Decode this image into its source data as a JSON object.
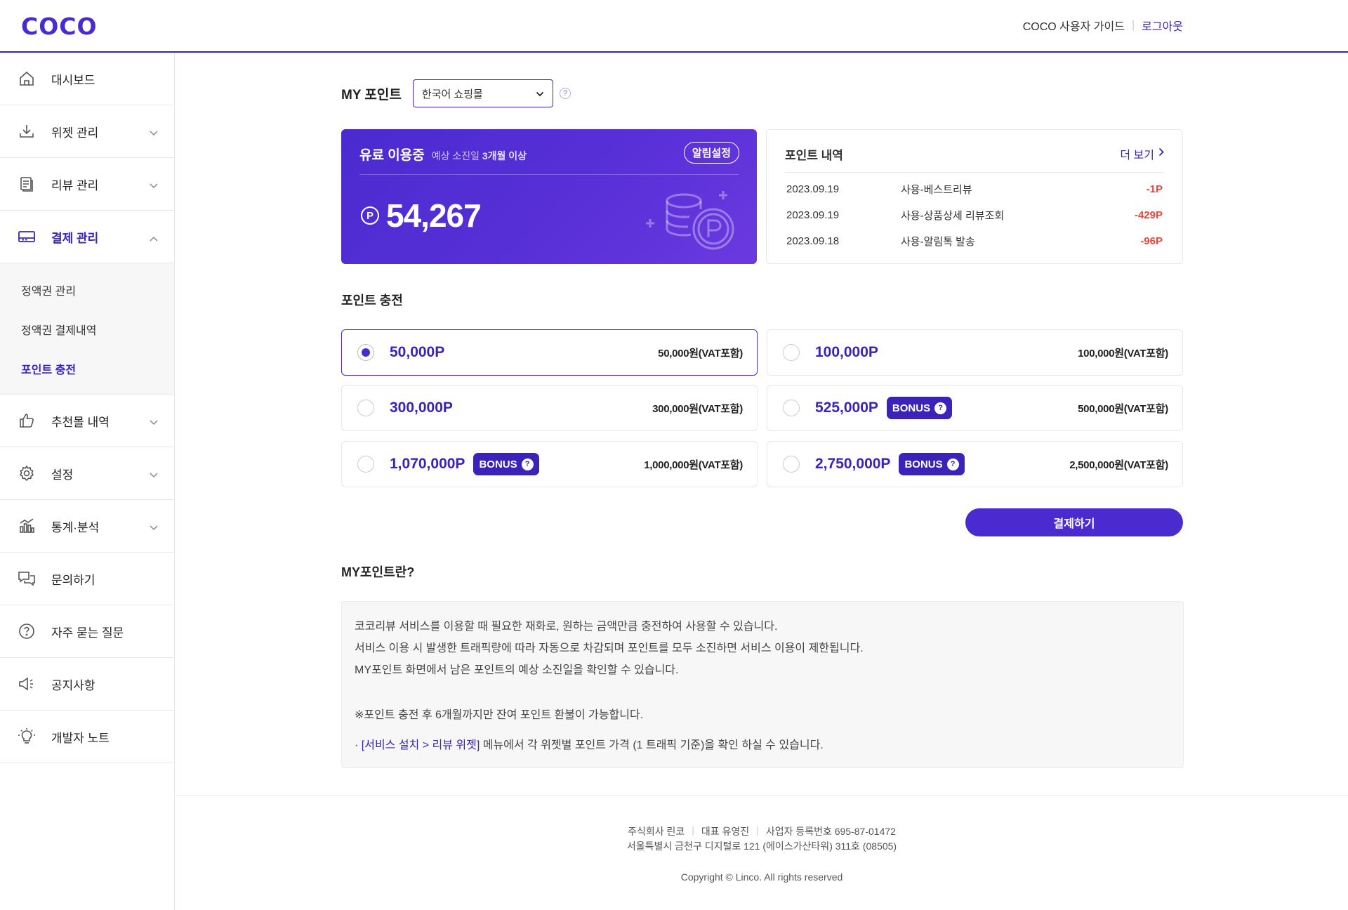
{
  "header": {
    "logo": "COCO",
    "guide_link": "COCO 사용자 가이드",
    "separator": "|",
    "logout": "로그아웃"
  },
  "sidebar": {
    "items": [
      {
        "label": "대시보드",
        "icon": "home-icon"
      },
      {
        "label": "위젯 관리",
        "icon": "download-icon"
      },
      {
        "label": "리뷰 관리",
        "icon": "document-icon"
      },
      {
        "label": "결제 관리",
        "icon": "credit-card-icon"
      },
      {
        "label": "추천몰 내역",
        "icon": "thumbs-up-icon"
      },
      {
        "label": "설정",
        "icon": "gear-icon"
      },
      {
        "label": "통계·분석",
        "icon": "chart-icon"
      },
      {
        "label": "문의하기",
        "icon": "chat-icon"
      },
      {
        "label": "자주 묻는 질문",
        "icon": "question-circle-icon"
      },
      {
        "label": "공지사항",
        "icon": "megaphone-icon"
      },
      {
        "label": "개발자 노트",
        "icon": "lightbulb-icon"
      }
    ],
    "payment_submenu": [
      "정액권 관리",
      "정액권 결제내역",
      "포인트 충전"
    ]
  },
  "mypoint": {
    "title": "MY 포인트",
    "selected_mall": "한국어 쇼핑몰",
    "help": "?"
  },
  "paid_card": {
    "status": "유료 이용중",
    "expiry_prefix": "예상 소진일",
    "expiry_value": "3개월 이상",
    "alarm_button": "알림설정",
    "point_symbol": "P",
    "amount": "54,267"
  },
  "history": {
    "title": "포인트 내역",
    "more": "더 보기",
    "rows": [
      {
        "date": "2023.09.19",
        "desc": "사용-베스트리뷰",
        "amount": "-1P"
      },
      {
        "date": "2023.09.19",
        "desc": "사용-상품상세 리뷰조회",
        "amount": "-429P"
      },
      {
        "date": "2023.09.18",
        "desc": "사용-알림톡 발송",
        "amount": "-96P"
      }
    ]
  },
  "charge": {
    "title": "포인트 충전",
    "bonus_label": "BONUS",
    "bonus_q": "?",
    "options": [
      {
        "points": "50,000P",
        "price": "50,000원(VAT포함)",
        "bonus": false,
        "selected": true
      },
      {
        "points": "100,000P",
        "price": "100,000원(VAT포함)",
        "bonus": false,
        "selected": false
      },
      {
        "points": "300,000P",
        "price": "300,000원(VAT포함)",
        "bonus": false,
        "selected": false
      },
      {
        "points": "525,000P",
        "price": "500,000원(VAT포함)",
        "bonus": true,
        "selected": false
      },
      {
        "points": "1,070,000P",
        "price": "1,000,000원(VAT포함)",
        "bonus": true,
        "selected": false
      },
      {
        "points": "2,750,000P",
        "price": "2,500,000원(VAT포함)",
        "bonus": true,
        "selected": false
      }
    ],
    "pay_button": "결제하기"
  },
  "about": {
    "title": "MY포인트란?",
    "lines": [
      "코코리뷰 서비스를 이용할 때 필요한 재화로, 원하는 금액만큼 충전하여 사용할 수 있습니다.",
      "서비스 이용 시 발생한 트래픽량에 따라 자동으로 차감되며 포인트를 모두 소진하면 서비스 이용이 제한됩니다.",
      "MY포인트 화면에서 남은 포인트의 예상 소진일을 확인할 수 있습니다."
    ],
    "note": "※포인트 충전 후 6개월까지만 잔여 포인트 환불이 가능합니다.",
    "link_prefix": "· ",
    "link_text": "[서비스 설치 > 리뷰 위젯]",
    "link_suffix": " 메뉴에서 각 위젯별 포인트 가격 (1 트래픽 기준)을 확인 하실 수 있습니다."
  },
  "footer": {
    "company": "주식회사 린코",
    "ceo": "대표 유영진",
    "biz_no": "사업자 등록번호 695-87-01472",
    "address": "서울특별시 금천구 디지털로 121 (에이스가산타워) 311호 (08505)",
    "copyright": "Copyright © Linco. All rights reserved"
  },
  "colors": {
    "accent": "#4a2bd0",
    "negative": "#f0443a"
  }
}
